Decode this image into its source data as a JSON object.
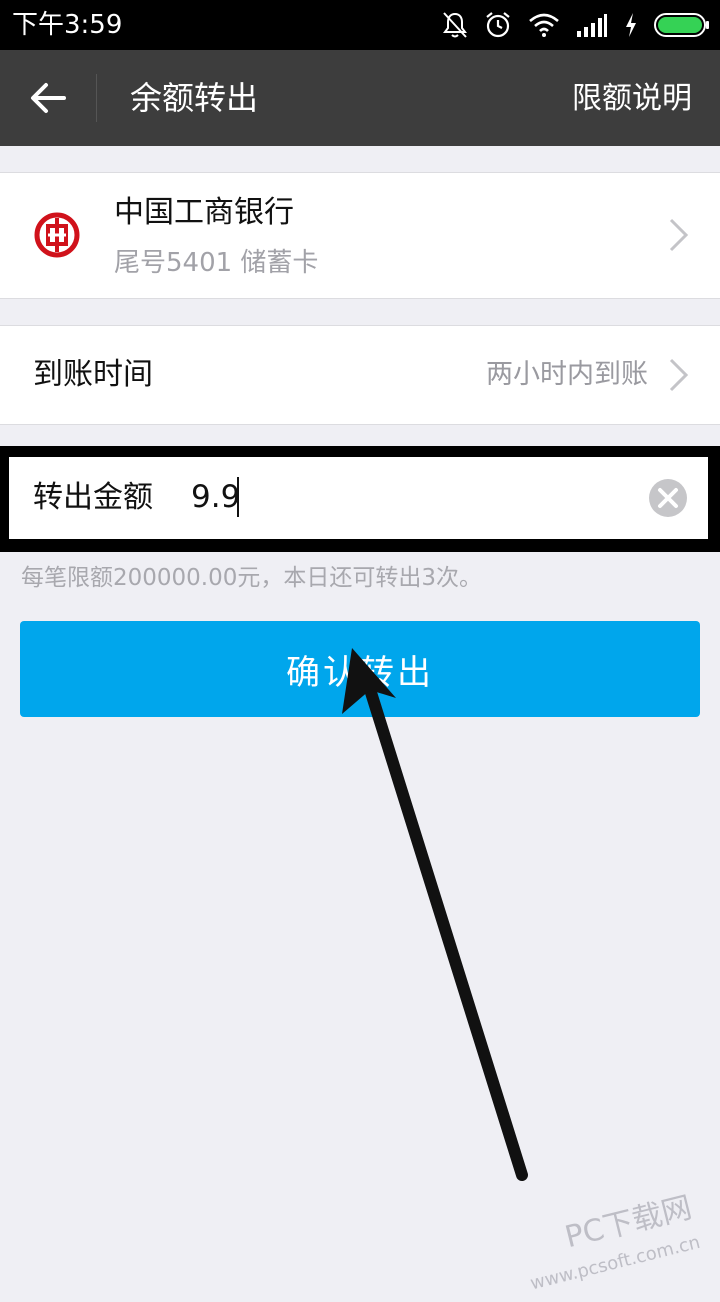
{
  "status_bar": {
    "time": "下午3:59",
    "icons": [
      "bell-off-icon",
      "alarm-icon",
      "wifi-icon",
      "signal-icon",
      "charging-icon",
      "battery-icon"
    ],
    "battery_color": "#35d255"
  },
  "app_bar": {
    "title": "余额转出",
    "right_action": "限额说明",
    "background": "#3d3d3d"
  },
  "bank_account": {
    "name": "中国工商银行",
    "detail": "尾号5401 储蓄卡",
    "logo_color": "#d0121b"
  },
  "arrival": {
    "label": "到账时间",
    "value": "两小时内到账"
  },
  "amount": {
    "label": "转出金额",
    "value": "9.9"
  },
  "hint": "每笔限额200000.00元，本日还可转出3次。",
  "confirm_button": {
    "label": "确认转出",
    "color": "#00a6ec"
  },
  "watermark": {
    "text": "PC下载网",
    "url": "www.pcsoft.com.cn"
  }
}
